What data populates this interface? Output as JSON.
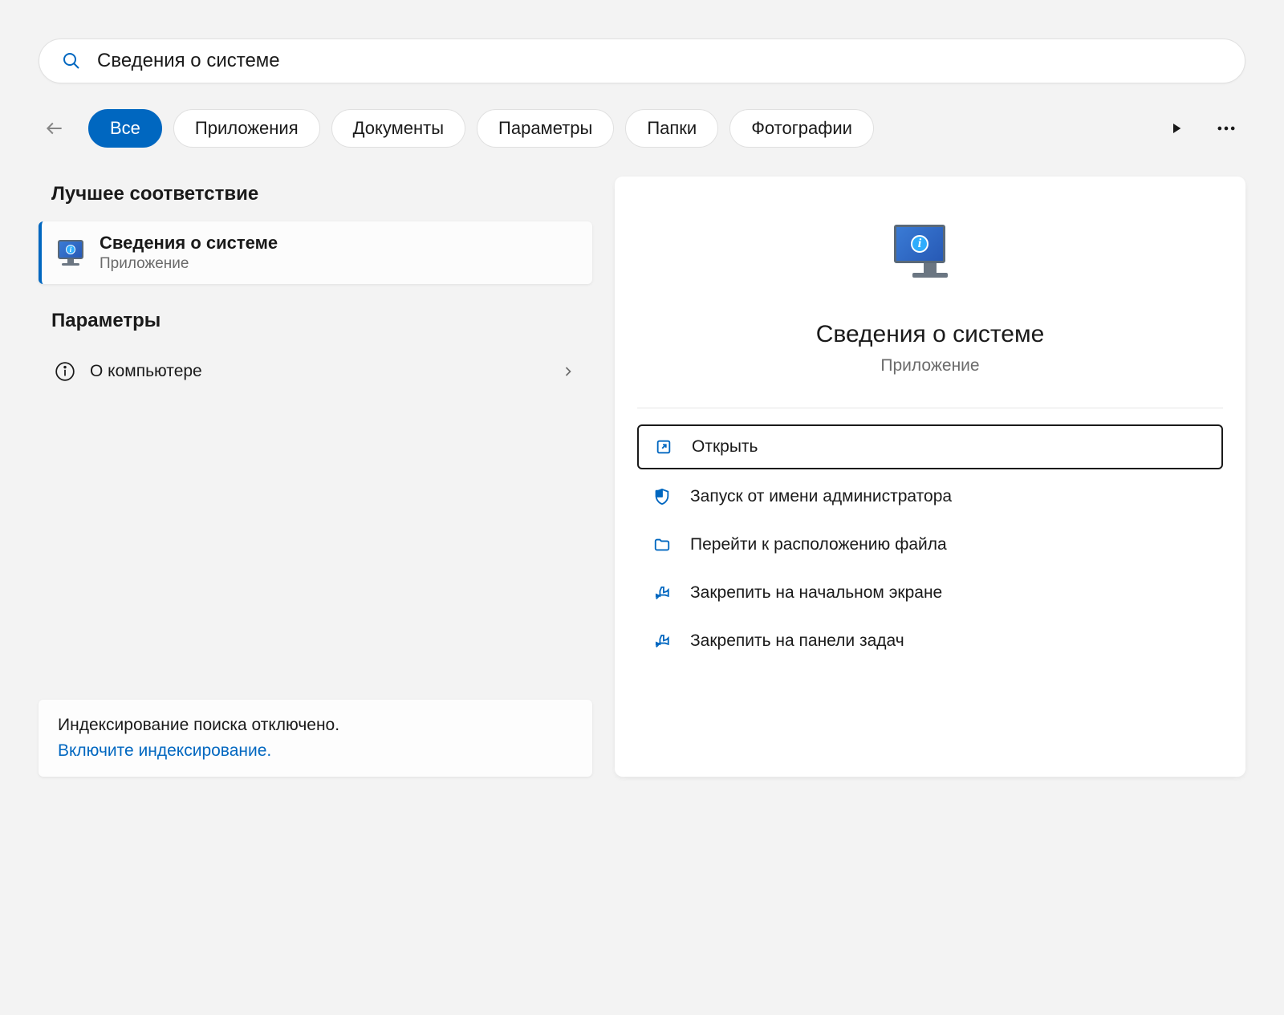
{
  "search": {
    "query": "Сведения о системе"
  },
  "tabs": {
    "all": "Все",
    "apps": "Приложения",
    "docs": "Документы",
    "settings": "Параметры",
    "folders": "Папки",
    "photos": "Фотографии"
  },
  "results": {
    "best_match_heading": "Лучшее соответствие",
    "best_match": {
      "title": "Сведения о системе",
      "subtitle": "Приложение"
    },
    "settings_heading": "Параметры",
    "settings_items": [
      {
        "label": "О компьютере"
      }
    ]
  },
  "footer": {
    "message": "Индексирование поиска отключено.",
    "link": "Включите индексирование."
  },
  "detail": {
    "title": "Сведения о системе",
    "subtitle": "Приложение",
    "actions": {
      "open": "Открыть",
      "run_admin": "Запуск от имени администратора",
      "open_location": "Перейти к расположению файла",
      "pin_start": "Закрепить на начальном экране",
      "pin_taskbar": "Закрепить на панели задач"
    }
  },
  "colors": {
    "accent": "#0067c0"
  }
}
